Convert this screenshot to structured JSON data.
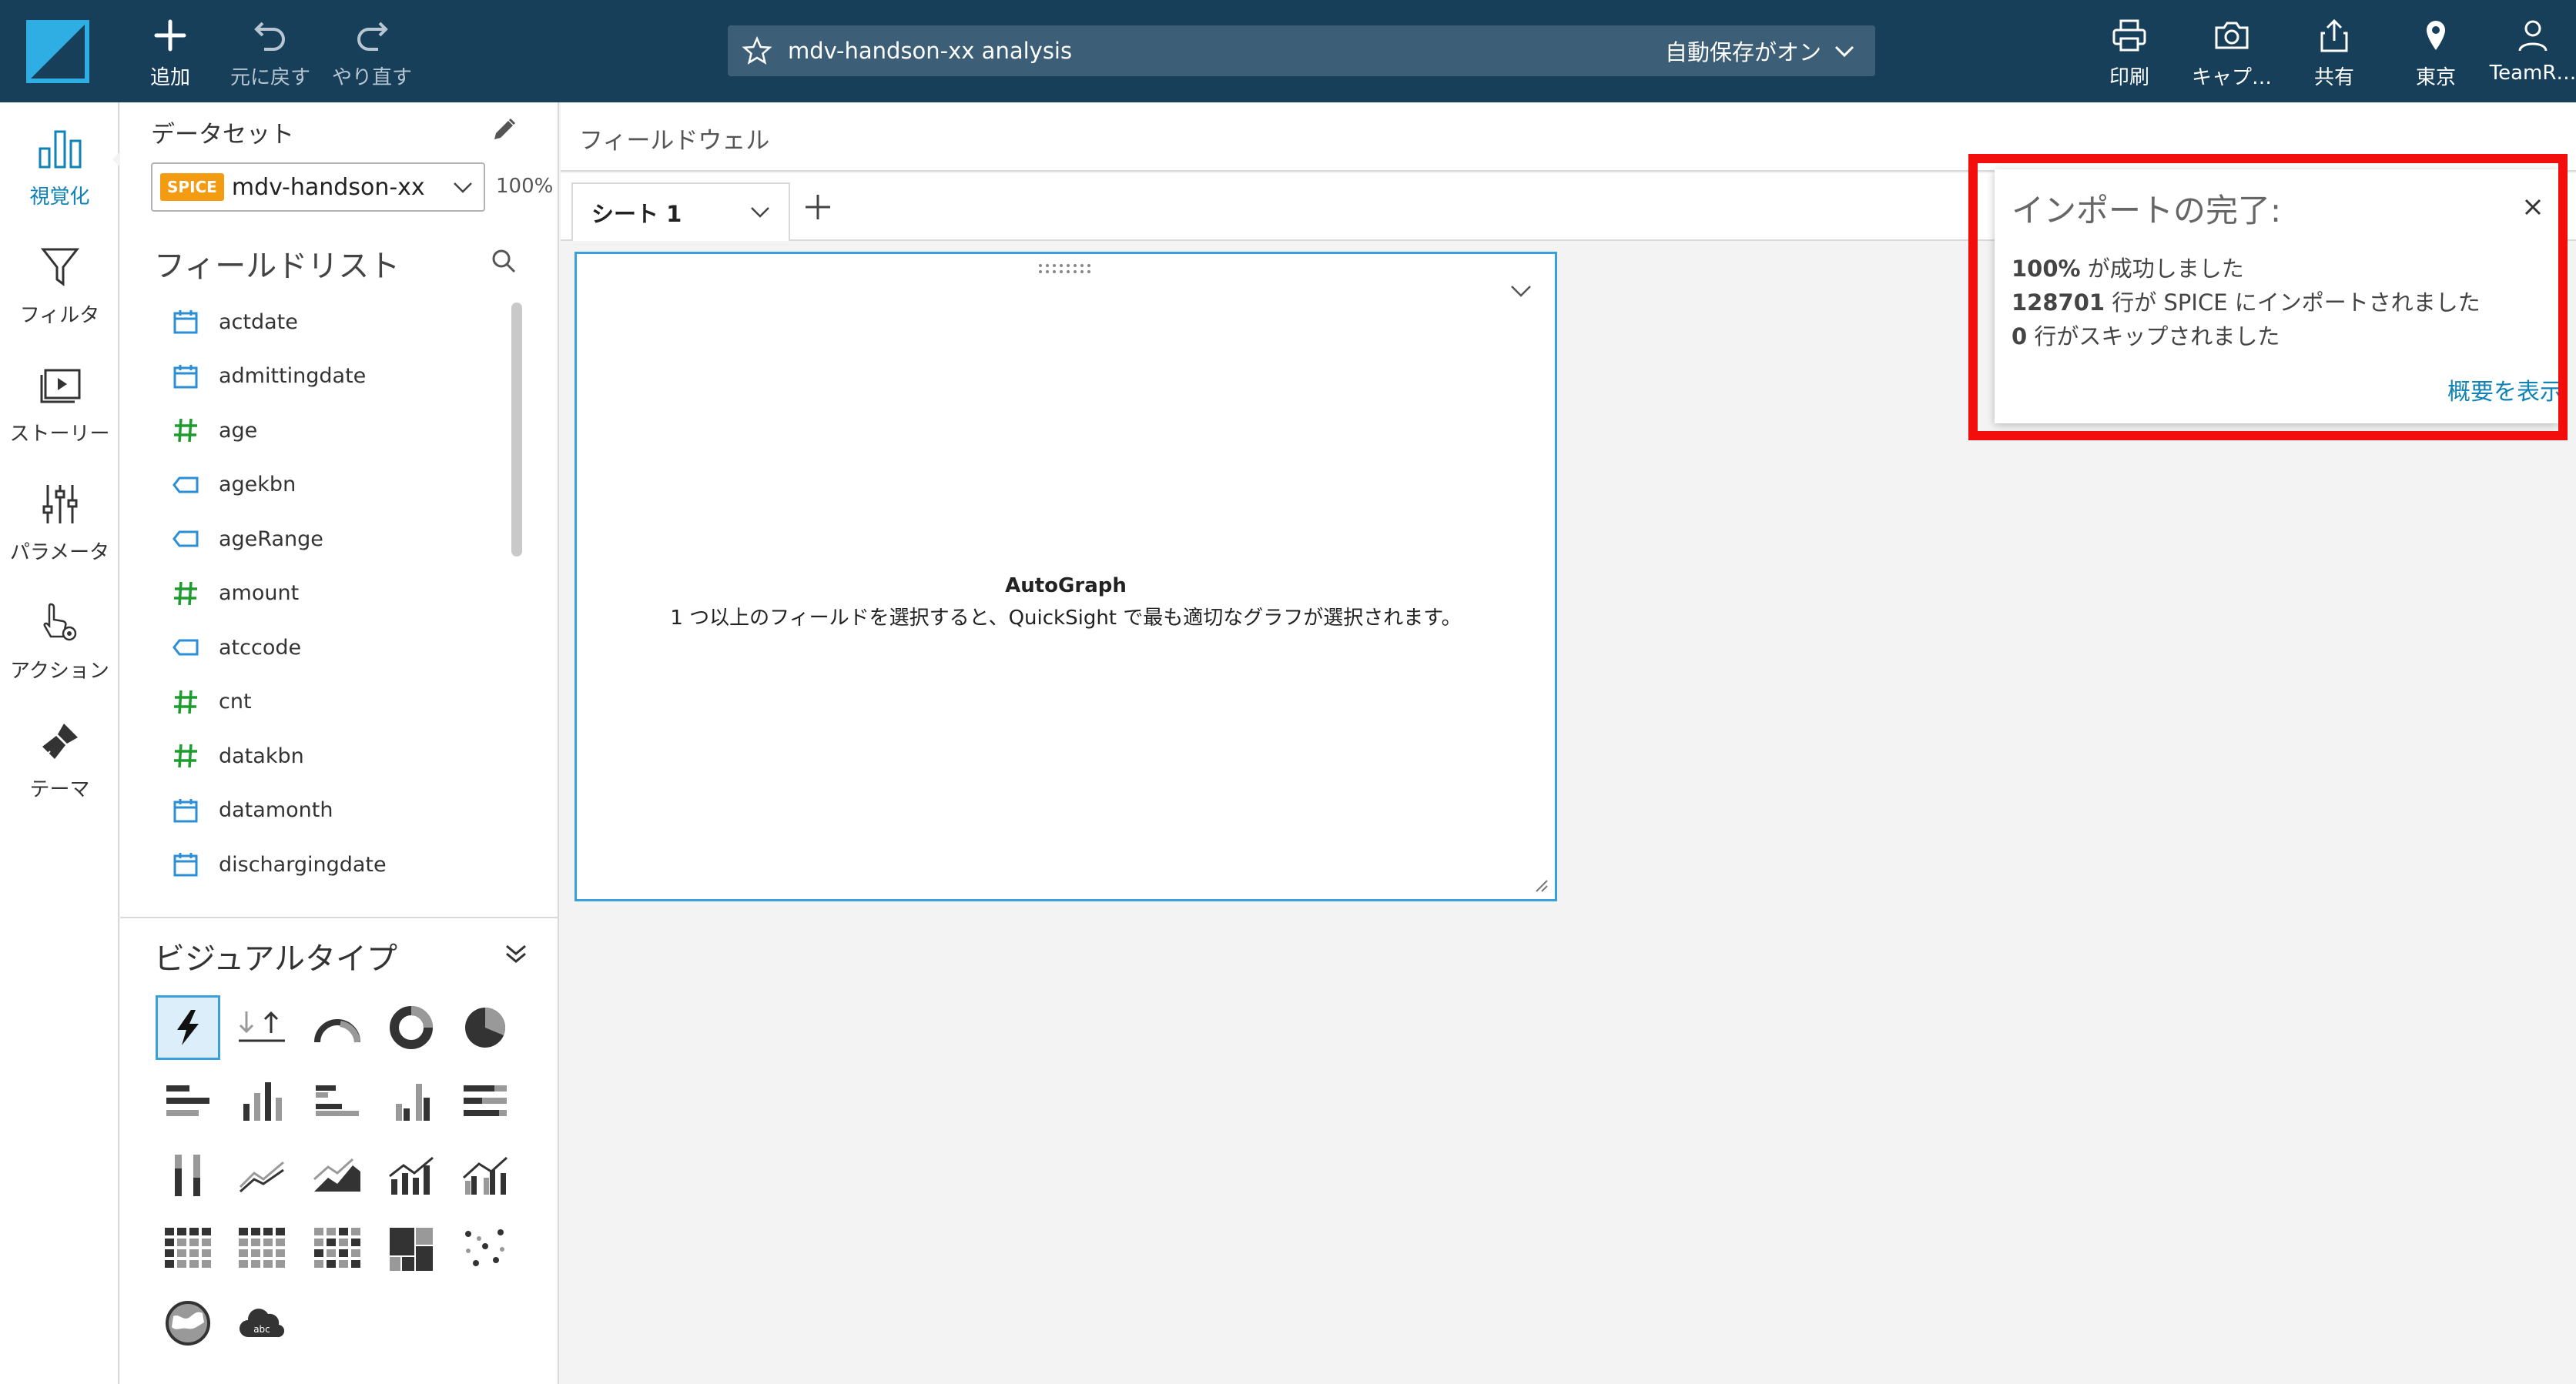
{
  "topbar": {
    "add_label": "追加",
    "undo_label": "元に戻す",
    "redo_label": "やり直す",
    "title": "mdv-handson-xx analysis",
    "autosave": "自動保存がオン",
    "print_label": "印刷",
    "capture_label": "キャプ…",
    "share_label": "共有",
    "region_label": "東京",
    "user_label": "TeamR…"
  },
  "iconbar": {
    "visualize": "視覚化",
    "filter": "フィルタ",
    "story": "ストーリー",
    "parameters": "パラメータ",
    "actions": "アクション",
    "themes": "テーマ"
  },
  "dataset": {
    "label": "データセット",
    "badge": "SPICE",
    "name": "mdv-handson-xx",
    "percent": "100%"
  },
  "field_list": {
    "title": "フィールドリスト",
    "items": [
      {
        "name": "actdate",
        "type": "date"
      },
      {
        "name": "admittingdate",
        "type": "date"
      },
      {
        "name": "age",
        "type": "number"
      },
      {
        "name": "agekbn",
        "type": "string"
      },
      {
        "name": "ageRange",
        "type": "string"
      },
      {
        "name": "amount",
        "type": "number"
      },
      {
        "name": "atccode",
        "type": "string"
      },
      {
        "name": "cnt",
        "type": "number"
      },
      {
        "name": "datakbn",
        "type": "number"
      },
      {
        "name": "datamonth",
        "type": "date"
      },
      {
        "name": "dischargingdate",
        "type": "date"
      }
    ]
  },
  "visual_types": {
    "title": "ビジュアルタイプ"
  },
  "main": {
    "field_well": "フィールドウェル",
    "sheet_tab": "シート 1",
    "autograph_title": "AutoGraph",
    "autograph_desc": "1 つ以上のフィールドを選択すると、QuickSight で最も適切なグラフが選択されます。"
  },
  "toast": {
    "title": "インポートの完了:",
    "line1_bold": "100%",
    "line1_rest": " が成功しました",
    "line2_bold": "128701",
    "line2_rest": " 行が SPICE にインポートされました",
    "line3_bold": "0",
    "line3_rest": " 行がスキップされました",
    "link": "概要を表示"
  },
  "colors": {
    "topbar": "#173f5a",
    "accent": "#0f82b6",
    "spice": "#f39c12",
    "highlight": "#f30e0e",
    "number_icon": "#1d9d2d"
  }
}
